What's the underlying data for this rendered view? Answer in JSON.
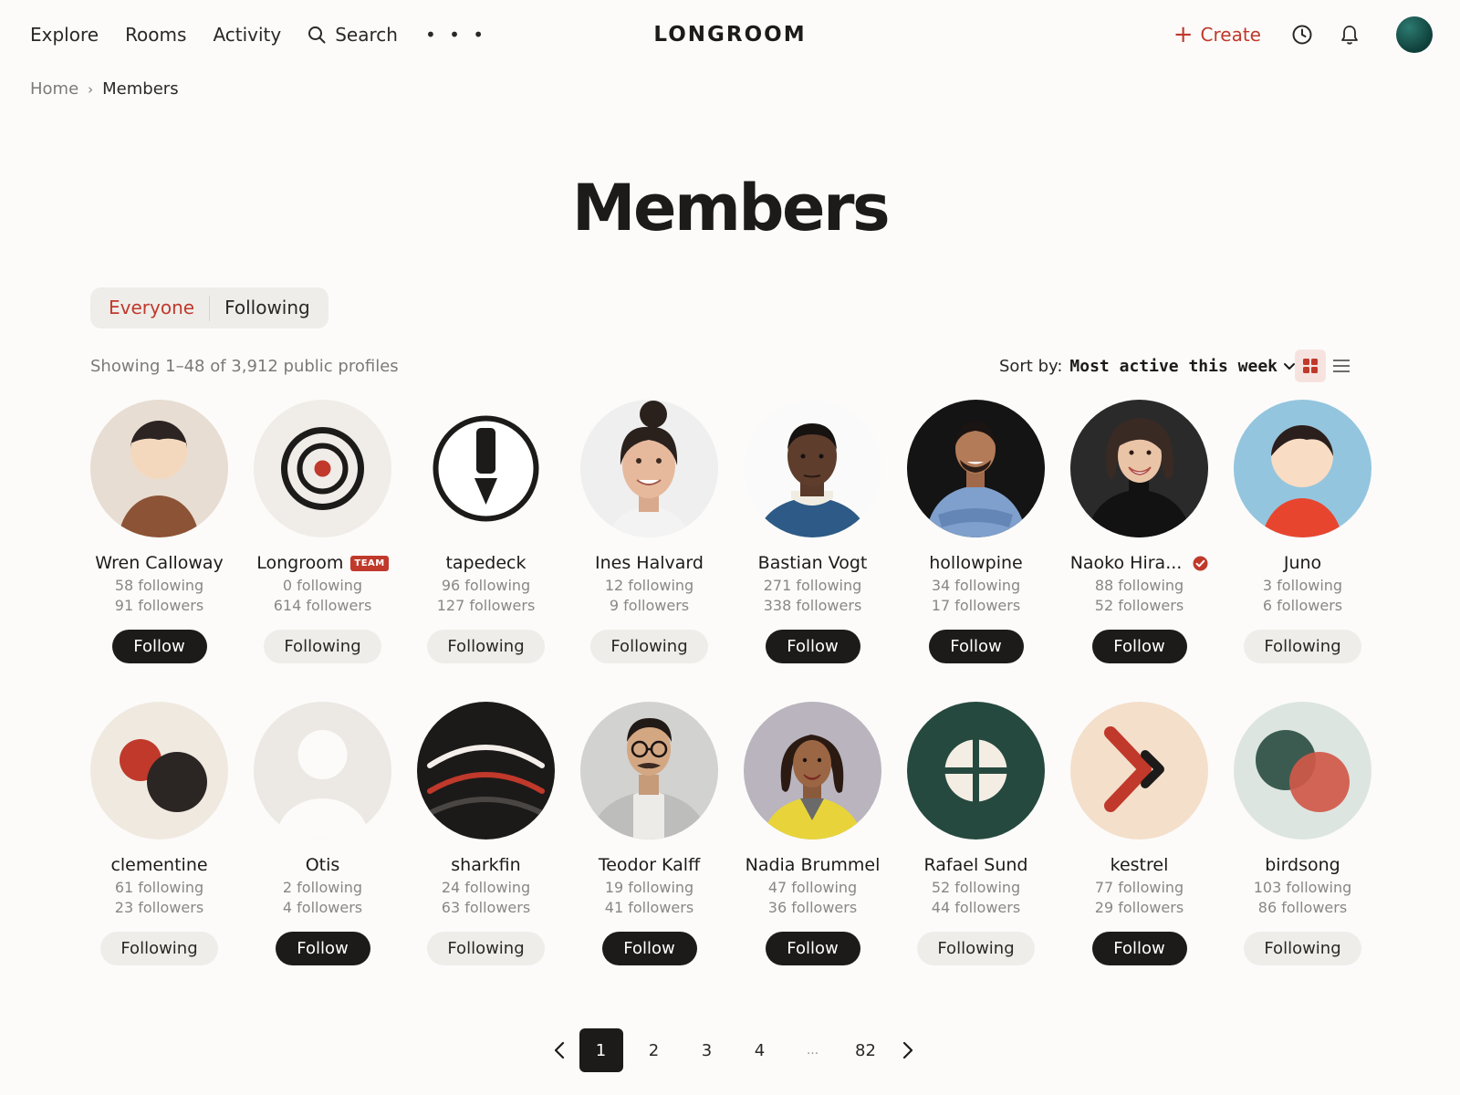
{
  "nav": {
    "links": [
      "Explore",
      "Rooms",
      "Activity"
    ],
    "search_label": "Search",
    "more_label": "• • •",
    "brand": "LONGROOM",
    "create_label": "Create",
    "icons": [
      "search-icon",
      "more-icon",
      "plus-icon",
      "history-icon",
      "bell-icon",
      "avatar"
    ]
  },
  "breadcrumb": {
    "home": "Home",
    "separator": "›",
    "current": "Members"
  },
  "title": "Members",
  "filter": {
    "everyone": "Everyone",
    "following": "Following",
    "selected": "Everyone"
  },
  "showing": "Showing 1–48 of 3,912 public profiles",
  "sort": {
    "label": "Sort by:",
    "value": "Most active this week"
  },
  "view": {
    "selected": "grid",
    "options": [
      "grid",
      "list"
    ]
  },
  "colors": {
    "accent": "#c0392b",
    "ink": "#1c1b1a",
    "muted": "#8a8784",
    "background": "#fcfbfa",
    "pill": "#efedea"
  },
  "members": [
    {
      "name": "Wren Calloway",
      "following": "58 following",
      "followers": "91 followers",
      "button": "Follow",
      "avatar": "illustrated-person"
    },
    {
      "name": "Longroom",
      "badge": "TEAM",
      "following": "0 following",
      "followers": "614 followers",
      "button": "Following",
      "avatar": "target-logo"
    },
    {
      "name": "tapedeck",
      "following": "96 following",
      "followers": "127 followers",
      "button": "Following",
      "avatar": "pen-nib-logo"
    },
    {
      "name": "Ines Halvard",
      "following": "12 following",
      "followers": "9 followers",
      "button": "Following",
      "avatar": "photo"
    },
    {
      "name": "Bastian Vogt",
      "following": "271 following",
      "followers": "338 followers",
      "button": "Follow",
      "avatar": "photo"
    },
    {
      "name": "hollowpine",
      "following": "34 following",
      "followers": "17 followers",
      "button": "Follow",
      "avatar": "photo"
    },
    {
      "name": "Naoko Hira...",
      "verified": true,
      "following": "88 following",
      "followers": "52 followers",
      "button": "Follow",
      "avatar": "photo"
    },
    {
      "name": "Juno",
      "following": "3 following",
      "followers": "6 followers",
      "button": "Following",
      "avatar": "illustrated-person"
    },
    {
      "name": "clementine",
      "following": "61 following",
      "followers": "23 followers",
      "button": "Following",
      "avatar": "two-dots"
    },
    {
      "name": "Otis",
      "following": "2 following",
      "followers": "4 followers",
      "button": "Follow",
      "avatar": "default-person"
    },
    {
      "name": "sharkfin",
      "following": "24 following",
      "followers": "63 followers",
      "button": "Following",
      "avatar": "arcs-logo"
    },
    {
      "name": "Teodor Kalff",
      "following": "19 following",
      "followers": "41 followers",
      "button": "Follow",
      "avatar": "photo"
    },
    {
      "name": "Nadia Brummel",
      "following": "47 following",
      "followers": "36 followers",
      "button": "Follow",
      "avatar": "photo"
    },
    {
      "name": "Rafael Sund",
      "following": "52 following",
      "followers": "44 followers",
      "button": "Following",
      "avatar": "cross-circle-logo"
    },
    {
      "name": "kestrel",
      "following": "77 following",
      "followers": "29 followers",
      "button": "Follow",
      "avatar": "chevrons-logo"
    },
    {
      "name": "birdsong",
      "following": "103 following",
      "followers": "86 followers",
      "button": "Following",
      "avatar": "overlap-circles"
    }
  ],
  "pagination": {
    "pages": [
      "1",
      "2",
      "3",
      "4"
    ],
    "ellipsis": "...",
    "last": "82",
    "current": "1"
  }
}
